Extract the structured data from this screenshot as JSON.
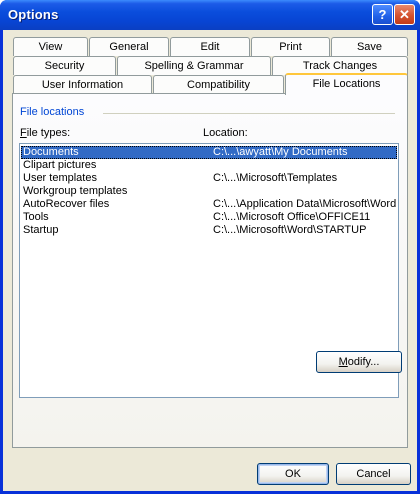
{
  "window": {
    "title": "Options",
    "help_glyph": "?",
    "close_glyph": "✕"
  },
  "tabs": {
    "row1": [
      "View",
      "General",
      "Edit",
      "Print",
      "Save"
    ],
    "row2": [
      "Security",
      "Spelling & Grammar",
      "Track Changes"
    ],
    "row3": [
      "User Information",
      "Compatibility",
      "File Locations"
    ],
    "active": "File Locations"
  },
  "file_locations": {
    "group_label": "File locations",
    "file_types_label_accel": "F",
    "file_types_label_rest": "ile types:",
    "location_label": "Location:",
    "rows": [
      {
        "type": "Documents",
        "location": "C:\\...\\awyatt\\My Documents",
        "selected": true
      },
      {
        "type": "Clipart pictures",
        "location": ""
      },
      {
        "type": "User templates",
        "location": "C:\\...\\Microsoft\\Templates"
      },
      {
        "type": "Workgroup templates",
        "location": ""
      },
      {
        "type": "AutoRecover files",
        "location": "C:\\...\\Application Data\\Microsoft\\Word"
      },
      {
        "type": "Tools",
        "location": "C:\\...\\Microsoft Office\\OFFICE11"
      },
      {
        "type": "Startup",
        "location": "C:\\...\\Microsoft\\Word\\STARTUP"
      }
    ],
    "modify_accel": "M",
    "modify_rest": "odify..."
  },
  "buttons": {
    "ok": "OK",
    "cancel": "Cancel"
  },
  "colors": {
    "titlebar": "#0a4ddc",
    "selection": "#316ac5",
    "group_label": "#0046d5",
    "active_tab_accent": "#ffc73c"
  }
}
